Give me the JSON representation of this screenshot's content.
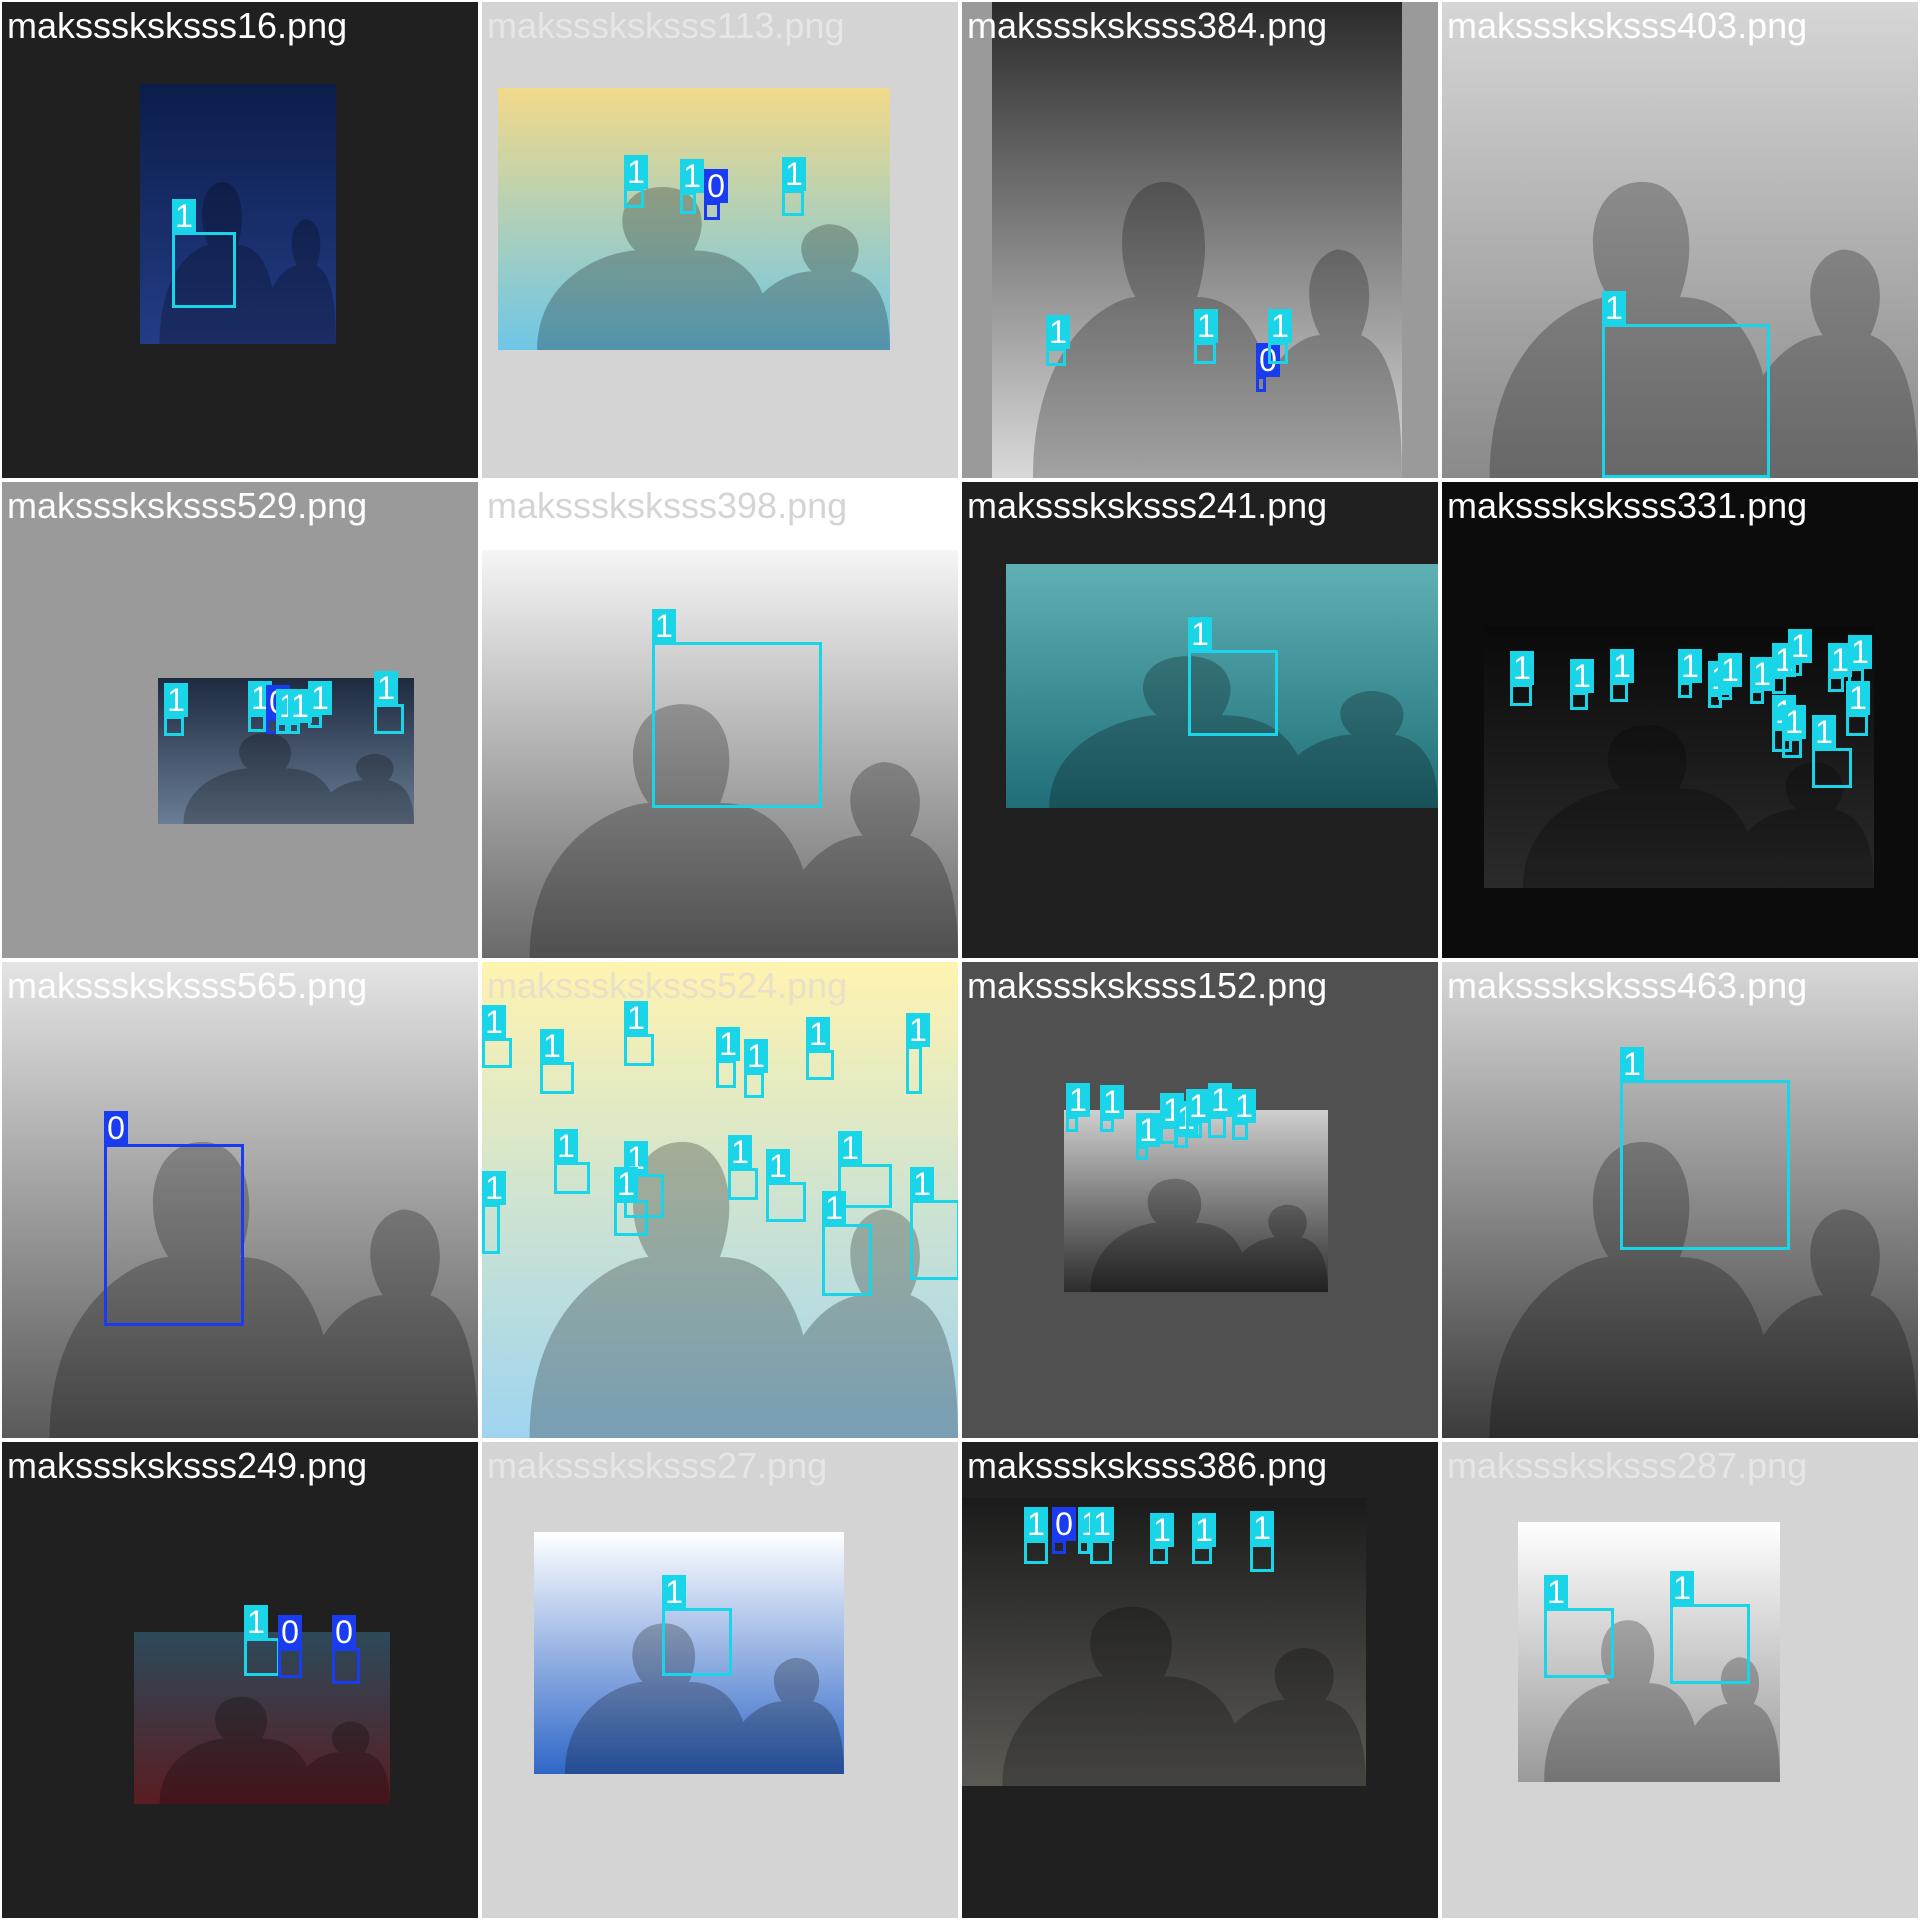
{
  "grid": {
    "columns": 4,
    "tile_colors": [
      "#202020",
      "#d4d4d4",
      "#9a9a9a",
      "#505050",
      "#ffffff",
      "#0c0c0c"
    ]
  },
  "class_colors": {
    "1": "#1ad4e8",
    "0": "#1a3cf0"
  },
  "tiles": [
    {
      "filename": "maksssksksss16.png",
      "bg": "#202020",
      "label_color": "#ffffff",
      "photo_tone": [
        "#0b1d4a",
        "#233c86"
      ],
      "detections": [
        {
          "label": "1"
        }
      ]
    },
    {
      "filename": "maksssksksss113.png",
      "bg": "#d4d4d4",
      "label_color": "#e6e6e6",
      "photo_tone": [
        "#f2d98a",
        "#6ec6e6"
      ],
      "detections": [
        {
          "label": "1"
        },
        {
          "label": "1"
        },
        {
          "label": "0"
        },
        {
          "label": "1"
        }
      ]
    },
    {
      "filename": "maksssksksss384.png",
      "bg": "#9a9a9a",
      "label_color": "#ffffff",
      "photo_tone": [
        "#2a2a2a",
        "#d9d9d9"
      ],
      "detections": [
        {
          "label": "1"
        },
        {
          "label": "1"
        },
        {
          "label": "0"
        },
        {
          "label": "1"
        }
      ]
    },
    {
      "filename": "maksssksksss403.png",
      "bg": "#9a9a9a",
      "label_color": "#ffffff",
      "photo_tone": [
        "#d6d6d6",
        "#8a8a8a"
      ],
      "detections": [
        {
          "label": "1"
        }
      ]
    },
    {
      "filename": "maksssksksss529.png",
      "bg": "#9a9a9a",
      "label_color": "#ffffff",
      "photo_tone": [
        "#1d2a40",
        "#6a7d95"
      ],
      "detections": [
        {
          "label": "1"
        },
        {
          "label": "1"
        },
        {
          "label": "0"
        },
        {
          "label": "1"
        },
        {
          "label": "1"
        },
        {
          "label": "1"
        },
        {
          "label": "1"
        }
      ]
    },
    {
      "filename": "maksssksksss398.png",
      "bg": "#ffffff",
      "label_color": "#d4d4d4",
      "photo_tone": [
        "#f5f5f5",
        "#6a6a6a"
      ],
      "detections": [
        {
          "label": "1"
        }
      ]
    },
    {
      "filename": "maksssksksss241.png",
      "bg": "#202020",
      "label_color": "#ffffff",
      "photo_tone": [
        "#5fb1b4",
        "#1f6e78"
      ],
      "detections": [
        {
          "label": "1"
        }
      ]
    },
    {
      "filename": "maksssksksss331.png",
      "bg": "#0c0c0c",
      "label_color": "#ffffff",
      "photo_tone": [
        "#0a0a0a",
        "#2b2b2b"
      ],
      "detections": [
        {
          "label": "1"
        },
        {
          "label": "1"
        },
        {
          "label": "1"
        },
        {
          "label": "1"
        },
        {
          "label": "1"
        },
        {
          "label": "1"
        },
        {
          "label": "1"
        },
        {
          "label": "1"
        },
        {
          "label": "1"
        },
        {
          "label": "1"
        },
        {
          "label": "1"
        },
        {
          "label": "1"
        },
        {
          "label": "1"
        },
        {
          "label": "1"
        },
        {
          "label": "1"
        }
      ]
    },
    {
      "filename": "maksssksksss565.png",
      "bg": "#c8c8c8",
      "label_color": "#ffffff",
      "photo_tone": [
        "#e4e4e4",
        "#5a5a5a"
      ],
      "detections": [
        {
          "label": "0"
        }
      ]
    },
    {
      "filename": "maksssksksss524.png",
      "bg": "#f4e8b8",
      "label_color": "#e9e0c8",
      "photo_tone": [
        "#fff3b0",
        "#9fd4f0"
      ],
      "detections": [
        {
          "label": "1"
        },
        {
          "label": "1"
        },
        {
          "label": "1"
        },
        {
          "label": "1"
        },
        {
          "label": "1"
        },
        {
          "label": "1"
        },
        {
          "label": "1"
        },
        {
          "label": "1"
        },
        {
          "label": "1"
        },
        {
          "label": "1"
        },
        {
          "label": "1"
        },
        {
          "label": "1"
        },
        {
          "label": "1"
        },
        {
          "label": "1"
        },
        {
          "label": "1"
        },
        {
          "label": "1"
        }
      ]
    },
    {
      "filename": "maksssksksss152.png",
      "bg": "#505050",
      "label_color": "#ffffff",
      "photo_tone": [
        "#cfcfcf",
        "#2d2d2d"
      ],
      "detections": [
        {
          "label": "1"
        },
        {
          "label": "1"
        },
        {
          "label": "1"
        },
        {
          "label": "1"
        },
        {
          "label": "1"
        },
        {
          "label": "1"
        },
        {
          "label": "1"
        },
        {
          "label": "1"
        }
      ]
    },
    {
      "filename": "maksssksksss463.png",
      "bg": "#e8e8e8",
      "label_color": "#ffffff",
      "photo_tone": [
        "#d8d8d8",
        "#3c3c3c"
      ],
      "detections": [
        {
          "label": "1"
        }
      ]
    },
    {
      "filename": "maksssksksss249.png",
      "bg": "#202020",
      "label_color": "#ffffff",
      "photo_tone": [
        "#2c4a5a",
        "#5a1c22"
      ],
      "detections": [
        {
          "label": "1"
        },
        {
          "label": "0"
        },
        {
          "label": "0"
        }
      ]
    },
    {
      "filename": "maksssksksss27.png",
      "bg": "#d4d4d4",
      "label_color": "#e6e6e6",
      "photo_tone": [
        "#ffffff",
        "#2f67c8"
      ],
      "detections": [
        {
          "label": "1"
        }
      ]
    },
    {
      "filename": "maksssksksss386.png",
      "bg": "#202020",
      "label_color": "#ffffff",
      "photo_tone": [
        "#1b1b1b",
        "#5b5a54"
      ],
      "detections": [
        {
          "label": "1"
        },
        {
          "label": "0"
        },
        {
          "label": "1"
        },
        {
          "label": "1"
        },
        {
          "label": "1"
        },
        {
          "label": "1"
        },
        {
          "label": "1"
        }
      ]
    },
    {
      "filename": "maksssksksss287.png",
      "bg": "#d4d4d4",
      "label_color": "#e6e6e6",
      "photo_tone": [
        "#ffffff",
        "#9a9a9a"
      ],
      "detections": [
        {
          "label": "1"
        },
        {
          "label": "1"
        }
      ]
    }
  ]
}
